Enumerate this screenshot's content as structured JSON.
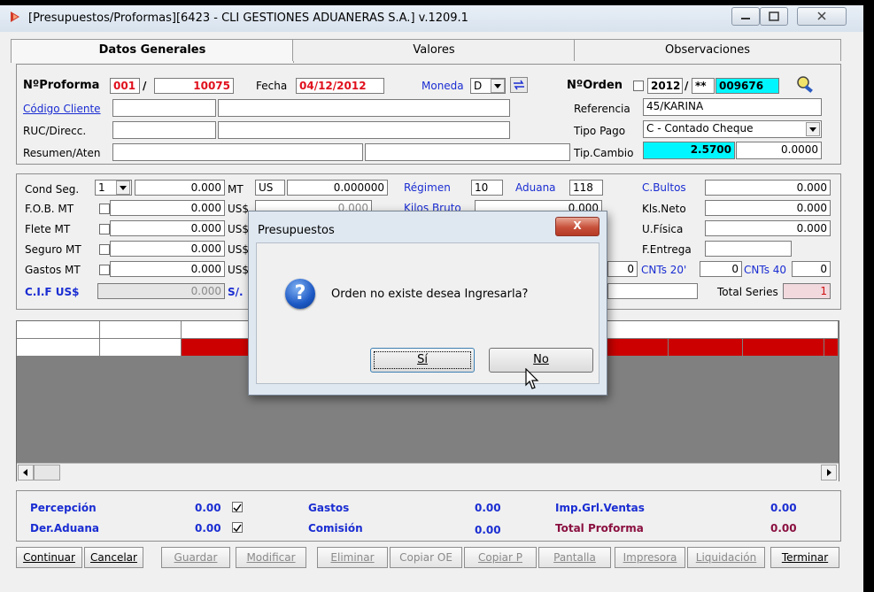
{
  "window": {
    "title": "[Presupuestos/Proformas][6423 - CLI GESTIONES ADUANERAS S.A.] v.1209.1"
  },
  "tabs": [
    {
      "label": "Datos Generales",
      "active": true
    },
    {
      "label": "Valores",
      "active": false
    },
    {
      "label": "Observaciones",
      "active": false
    }
  ],
  "header": {
    "nro_proforma_label": "NºProforma",
    "nro_proforma_serie": "001",
    "slash": "/",
    "nro_proforma_numero": "10075",
    "fecha_label": "Fecha",
    "fecha_value": "04/12/2012",
    "moneda_label": "Moneda",
    "moneda_value": "D",
    "nro_orden_label": "NºOrden",
    "nro_orden_year": "2012",
    "nro_orden_mid": "**",
    "nro_orden_value": "009676",
    "codigo_cliente_label": "Código Cliente",
    "ruc_label": "RUC/Direcc.",
    "resumen_label": "Resumen/Aten",
    "referencia_label": "Referencia",
    "referencia_value": "45/KARINA",
    "tipo_pago_label": "Tipo Pago",
    "tipo_pago_value": "C  - Contado Cheque",
    "tip_cambio_label": "Tip.Cambio",
    "tip_cambio_value": "2.5700",
    "tip_cambio_value2": "0.0000"
  },
  "valores": {
    "cond_seg_label": "Cond Seg.",
    "cond_seg_value": "1",
    "cond_seg_amount": "0.000",
    "mt_label": "MT",
    "us_value": "US",
    "rate_value": "0.000000",
    "regimen_label": "Régimen",
    "regimen_value": "10",
    "aduana_label": "Aduana",
    "aduana_value": "118",
    "c_bultos_label": "C.Bultos",
    "c_bultos_value": "0.000",
    "fob_label": "F.O.B.  MT",
    "fob_value": "0.000",
    "fob_us_label": "US$",
    "fob_us_value": "0.000",
    "kilos_bruto_label": "Kilos Bruto",
    "kilos_bruto_value": "0.000",
    "kls_neto_label": "Kls.Neto",
    "kls_neto_value": "0.000",
    "flete_label": "Flete   MT",
    "flete_value": "0.000",
    "flete_us_label": "US$",
    "u_fisica_label": "U.Física",
    "u_fisica_value": "0.000",
    "seguro_label": "Seguro MT",
    "seguro_value": "0.000",
    "seguro_us_label": "US$",
    "f_entrega_label": "F.Entrega",
    "gastos_label": "Gastos MT",
    "gastos_value": "0.000",
    "gastos_us_label": "US$",
    "cnt_zero": "0",
    "cnts20_label": "CNTs 20'",
    "cnts20_value": "0",
    "cnts40_label": "CNTs 40",
    "cnts40_value": "0",
    "cif_label": "C.I.F US$",
    "cif_value": "0.000",
    "soles_label": "S/.",
    "total_series_label": "Total Series",
    "total_series_value": "1"
  },
  "totals": {
    "percepcion_label": "Percepción",
    "percepcion_value": "0.00",
    "der_aduana_label": "Der.Aduana",
    "der_aduana_value": "0.00",
    "gastos_label": "Gastos",
    "gastos_value": "0.00",
    "comision_label": "Comisión",
    "comision_value": "0.00",
    "imp_grl_label": "Imp.Grl.Ventas",
    "imp_grl_value": "0.00",
    "total_label": "Total Proforma",
    "total_value": "0.00"
  },
  "toolbar": [
    {
      "label": "Continuar",
      "enabled": true
    },
    {
      "label": "Cancelar",
      "enabled": true
    },
    {
      "label": "Guardar",
      "enabled": false
    },
    {
      "label": "Modificar",
      "enabled": false
    },
    {
      "label": "Eliminar",
      "enabled": false
    },
    {
      "label": "Copiar OE",
      "enabled": false
    },
    {
      "label": "Copiar P",
      "enabled": false
    },
    {
      "label": "Pantalla",
      "enabled": false
    },
    {
      "label": "Impresora",
      "enabled": false
    },
    {
      "label": "Liquidación",
      "enabled": false
    },
    {
      "label": "Terminar",
      "enabled": true
    }
  ],
  "dialog": {
    "title": "Presupuestos",
    "close": "X",
    "message": "Orden no existe desea Ingresarla?",
    "yes": "Sí",
    "no": "No"
  },
  "colors": {
    "grid_red": "#cc0000",
    "cyan": "#00f6ff",
    "label_blue": "#1a2dd2"
  },
  "icons": {
    "app": "app-icon",
    "question": "question-icon",
    "cursor": "mouse-cursor-icon"
  }
}
